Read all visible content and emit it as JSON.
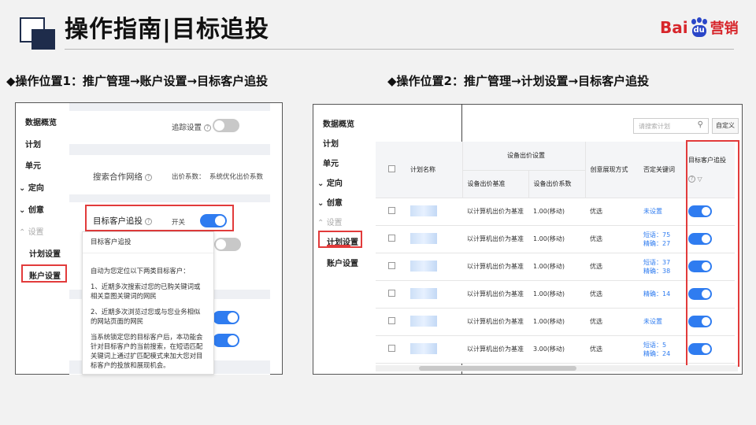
{
  "header": {
    "title": "操作指南|目标追投",
    "logo_bai": "Bai",
    "logo_du": "du",
    "logo_tail": "营销"
  },
  "locations": {
    "loc1": "◆操作位置1：推广管理→账户设置→目标客户追投",
    "loc2": "◆操作位置2：推广管理→计划设置→目标客户追投"
  },
  "left_panel": {
    "nav": [
      "数据概览",
      "计划",
      "单元",
      "定向",
      "创意",
      "设置",
      "计划设置",
      "账户设置"
    ],
    "track_label": "追踪设置",
    "network_label": "搜索合作网络",
    "bid_factor_label": "出价系数：",
    "bid_factor_value": "系统优化出价系数",
    "target_label": "目标客户追投",
    "switch_label": "开关",
    "tooltip": {
      "title": "目标客户追投",
      "lines": [
        "自动为您定位以下两类目标客户：",
        "1、近期多次搜索过您的已购关键词或相关意图关键词的网民",
        "2、近期多次浏览过您或与您业务相似的网站页面的网民",
        "当系统锁定您的目标客户后，本功能会针对目标客户的当前搜索，在短语匹配关键词上通过扩匹配模式来加大您对目标客户的投放和展现机会。"
      ]
    }
  },
  "right_panel": {
    "nav": [
      "数据概览",
      "计划",
      "单元",
      "定向",
      "创意",
      "设置",
      "计划设置",
      "账户设置"
    ],
    "search_placeholder": "请搜索计划",
    "custom_button": "自定义",
    "headers": {
      "plan_name": "计划名称",
      "device_bid_group": "设备出价设置",
      "device_bid_base": "设备出价基准",
      "device_bid_factor": "设备出价系数",
      "creative_mode": "创意展现方式",
      "negative_keywords": "否定关键词",
      "target_tracking": "目标客户追投"
    },
    "rows": [
      {
        "base": "以计算机出价为基准",
        "factor": "1.00(移动)",
        "mode": "优选",
        "neg1": "未设置",
        "neg2": ""
      },
      {
        "base": "以计算机出价为基准",
        "factor": "1.00(移动)",
        "mode": "优选",
        "neg1": "短语：75",
        "neg2": "精确：27"
      },
      {
        "base": "以计算机出价为基准",
        "factor": "1.00(移动)",
        "mode": "优选",
        "neg1": "短语：37",
        "neg2": "精确：38"
      },
      {
        "base": "以计算机出价为基准",
        "factor": "1.00(移动)",
        "mode": "优选",
        "neg1": "精确：14",
        "neg2": ""
      },
      {
        "base": "以计算机出价为基准",
        "factor": "1.00(移动)",
        "mode": "优选",
        "neg1": "未设置",
        "neg2": ""
      },
      {
        "base": "以计算机出价为基准",
        "factor": "3.00(移动)",
        "mode": "优选",
        "neg1": "短语：5",
        "neg2": "精确：24"
      }
    ]
  },
  "colors": {
    "accent": "#2f7cf0",
    "highlight": "#e23b3b",
    "deco": "#1e2c4b"
  }
}
